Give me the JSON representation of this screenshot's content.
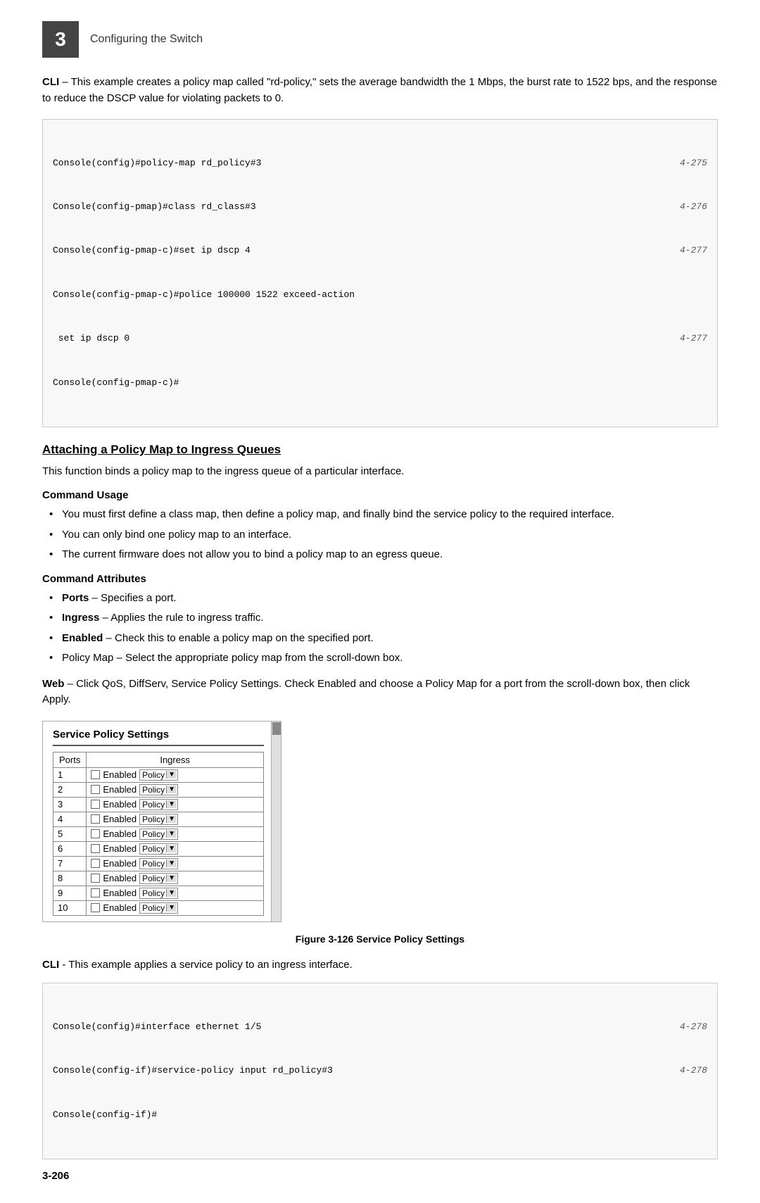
{
  "header": {
    "chapter_num": "3",
    "title": "Configuring the Switch"
  },
  "intro": {
    "text_parts": [
      {
        "bold": "CLI",
        "rest": " – This example creates a policy map called \"rd-policy,\" sets the average bandwidth the 1 Mbps, the burst rate to 1522 bps, and the response to reduce the DSCP value for violating packets to 0."
      }
    ]
  },
  "code_block_1": {
    "lines": [
      {
        "text": "Console(config)#policy-map rd_policy#3",
        "ref": "4-275"
      },
      {
        "text": "Console(config-pmap)#class rd_class#3",
        "ref": "4-276"
      },
      {
        "text": "Console(config-pmap-c)#set ip dscp 4",
        "ref": "4-277"
      },
      {
        "text": "Console(config-pmap-c)#police 100000 1522 exceed-action",
        "ref": ""
      },
      {
        "text": " set ip dscp 0",
        "ref": "4-277"
      },
      {
        "text": "Console(config-pmap-c)#",
        "ref": ""
      }
    ]
  },
  "section": {
    "heading": "Attaching a Policy Map to Ingress Queues",
    "intro": "This function binds a policy map to the ingress queue of a particular interface.",
    "command_usage_heading": "Command Usage",
    "bullets_usage": [
      "You must first define a class map, then define a policy map, and finally bind the service policy to the required interface.",
      "You can only bind one policy map to an interface.",
      "The current firmware does not allow you to bind a policy map to an egress queue."
    ],
    "command_attributes_heading": "Command Attributes",
    "bullets_attributes": [
      {
        "bold": "Ports",
        "rest": " – Specifies a port."
      },
      {
        "bold": "Ingress",
        "rest": " – Applies the rule to ingress traffic."
      },
      {
        "bold": "Enabled",
        "rest": " – Check this to enable a policy map on the specified port."
      },
      {
        "bold": "",
        "rest": "Policy Map – Select the appropriate policy map from the scroll-down box."
      }
    ]
  },
  "web_para": {
    "bold": "Web",
    "rest": " – Click QoS, DiffServ, Service Policy Settings. Check Enabled and choose a Policy Map for a port from the scroll-down box, then click Apply."
  },
  "service_policy": {
    "title": "Service Policy Settings",
    "table": {
      "col_ports": "Ports",
      "col_ingress": "Ingress",
      "rows": [
        {
          "port": "1",
          "enabled_label": "Enabled",
          "policy_text": "Policy"
        },
        {
          "port": "2",
          "enabled_label": "Enabled",
          "policy_text": "Policy"
        },
        {
          "port": "3",
          "enabled_label": "Enabled",
          "policy_text": "Policy"
        },
        {
          "port": "4",
          "enabled_label": "Enabled",
          "policy_text": "Policy"
        },
        {
          "port": "5",
          "enabled_label": "Enabled",
          "policy_text": "Policy"
        },
        {
          "port": "6",
          "enabled_label": "Enabled",
          "policy_text": "Policy"
        },
        {
          "port": "7",
          "enabled_label": "Enabled",
          "policy_text": "Policy"
        },
        {
          "port": "8",
          "enabled_label": "Enabled",
          "policy_text": "Policy"
        },
        {
          "port": "9",
          "enabled_label": "Enabled",
          "policy_text": "Policy"
        },
        {
          "port": "10",
          "enabled_label": "Enabled",
          "policy_text": "Policy"
        }
      ]
    }
  },
  "figure_caption": "Figure 3-126  Service Policy Settings",
  "cli_para": {
    "bold": "CLI",
    "rest": " - This example applies a service policy to an ingress interface."
  },
  "code_block_2": {
    "lines": [
      {
        "text": "Console(config)#interface ethernet 1/5",
        "ref": "4-278"
      },
      {
        "text": "Console(config-if)#service-policy input rd_policy#3",
        "ref": "4-278"
      },
      {
        "text": "Console(config-if)#",
        "ref": ""
      }
    ]
  },
  "page_number": "3-206"
}
